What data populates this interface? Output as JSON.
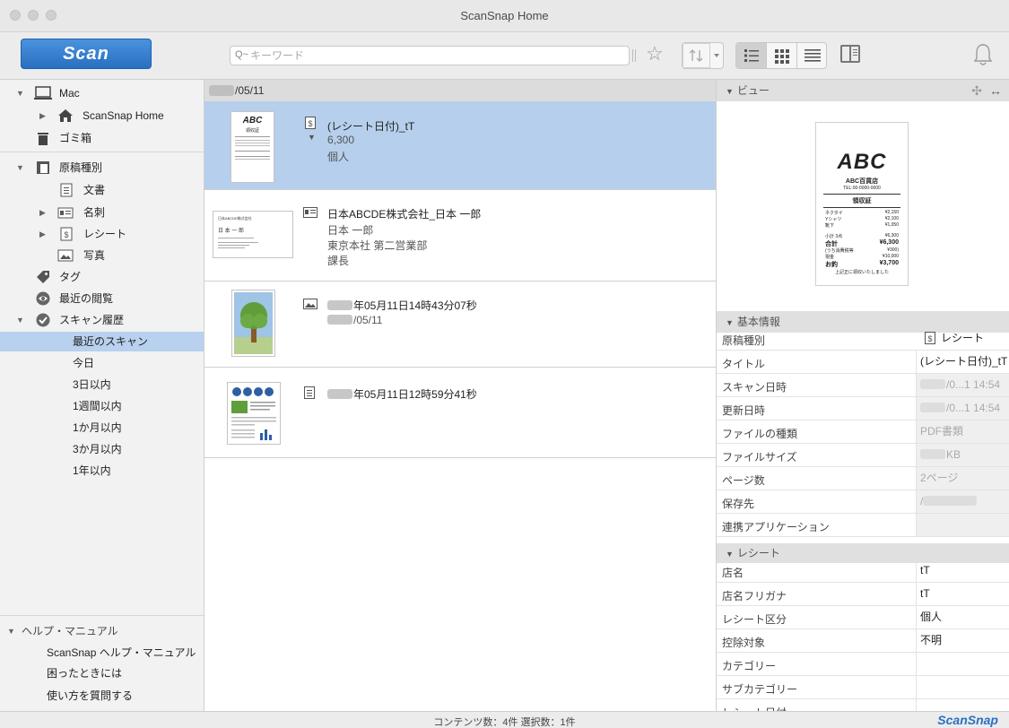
{
  "window": {
    "title": "ScanSnap Home"
  },
  "toolbar": {
    "scan_label": "Scan",
    "search_placeholder": "キーワード",
    "search_icon": "Q~"
  },
  "sidebar": {
    "mac": "Mac",
    "scansnap_home": "ScanSnap Home",
    "trash": "ゴミ箱",
    "doc_type": "原稿種別",
    "documents": "文書",
    "business_cards": "名刺",
    "receipts": "レシート",
    "photos": "写真",
    "tags": "タグ",
    "recently_viewed": "最近の閲覧",
    "scan_history": "スキャン履歴",
    "history_items": [
      "最近のスキャン",
      "今日",
      "3日以内",
      "1週間以内",
      "1か月以内",
      "3か月以内",
      "1年以内"
    ],
    "help_header": "ヘルプ・マニュアル",
    "help_items": [
      "ScanSnap ヘルプ・マニュアル",
      "困ったときには",
      "使い方を質問する"
    ]
  },
  "list": {
    "date_header": "/05/11",
    "items": [
      {
        "title": "(レシート日付)_tT",
        "line2": "6,300",
        "line3": "個人"
      },
      {
        "title": "日本ABCDE株式会社_日本 一郎",
        "line2": "日本 一郎",
        "line3": "東京本社 第二営業部",
        "line4": "課長"
      },
      {
        "title": "年05月11日14時43分07秒",
        "line2": "/05/11"
      },
      {
        "title": "年05月11日12時59分41秒"
      }
    ],
    "receipt_thumb": {
      "logo": "ABC",
      "title": "領収証"
    },
    "card_thumb": {
      "company": "日本ABCDE株式会社",
      "name": "日 本  一 郎"
    }
  },
  "preview": {
    "header": "ビュー",
    "logo": "ABC",
    "store": "ABC百貨店",
    "tel": "TEL:00-0000-0000",
    "title": "領収証",
    "lines": [
      {
        "item": "ネクタイ",
        "price": "¥2,150"
      },
      {
        "item": "Yシャツ",
        "price": "¥2,100"
      },
      {
        "item": "靴下",
        "price": "¥1,050"
      }
    ],
    "subtotal_label": "小計 3点",
    "subtotal": "¥6,300",
    "total_label": "合計",
    "total": "¥6,300",
    "tax_label": "(うち消費税等",
    "tax": "¥300)",
    "cash_label": "現金",
    "cash": "¥10,000",
    "change_label": "お釣",
    "change": "¥3,700",
    "footer": "上記正に領収いたしました"
  },
  "basic_info": {
    "header": "基本情報",
    "rows": [
      {
        "label": "原稿種別",
        "value": "レシート"
      },
      {
        "label": "タイトル",
        "value": "(レシート日付)_tT"
      },
      {
        "label": "スキャン日時",
        "value": "/0...1 14:54"
      },
      {
        "label": "更新日時",
        "value": "/0...1 14:54"
      },
      {
        "label": "ファイルの種類",
        "value": "PDF書類"
      },
      {
        "label": "ファイルサイズ",
        "value": "KB"
      },
      {
        "label": "ページ数",
        "value": "2ページ"
      },
      {
        "label": "保存先",
        "value": "/"
      },
      {
        "label": "連携アプリケーション",
        "value": ""
      }
    ]
  },
  "receipt_info": {
    "header": "レシート",
    "rows": [
      {
        "label": "店名",
        "value": "tT"
      },
      {
        "label": "店名フリガナ",
        "value": "tT"
      },
      {
        "label": "レシート区分",
        "value": "個人"
      },
      {
        "label": "控除対象",
        "value": "不明"
      },
      {
        "label": "カテゴリー",
        "value": ""
      },
      {
        "label": "サブカテゴリー",
        "value": ""
      },
      {
        "label": "レシート日付",
        "value": ""
      }
    ]
  },
  "status": {
    "text": "コンテンツ数：4件  選択数：1件",
    "brand": "ScanSnap"
  },
  "colors": {
    "accent": "#2a6fc2",
    "selection": "#b6cfec",
    "sidebar_selection": "#b8d1ee"
  }
}
